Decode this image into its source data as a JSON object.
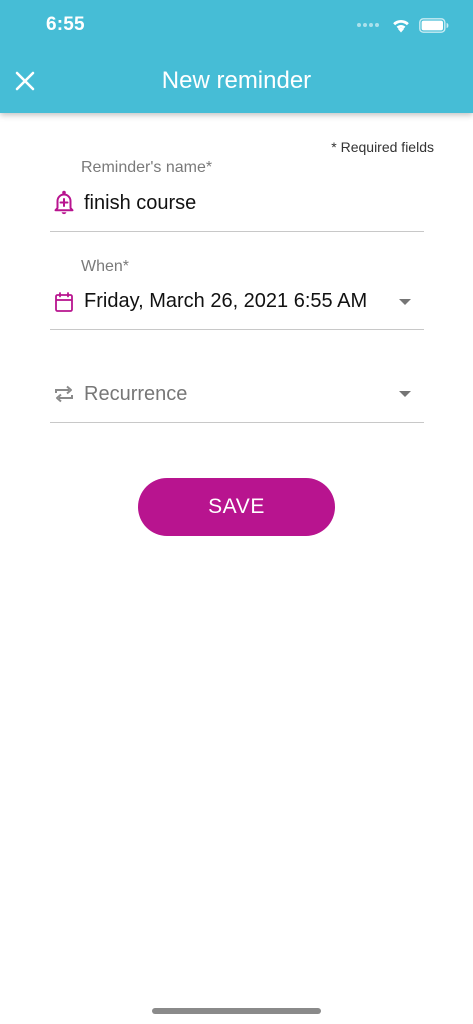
{
  "status_bar": {
    "time": "6:55"
  },
  "header": {
    "title": "New reminder",
    "background_color": "#46bdd6",
    "close_icon": "close-icon"
  },
  "form": {
    "required_note": "* Required fields",
    "name_field": {
      "label": "Reminder's name*",
      "value": "finish course",
      "icon": "bell-plus-icon"
    },
    "when_field": {
      "label": "When*",
      "value": "Friday, March 26, 2021 6:55 AM",
      "icon": "calendar-icon"
    },
    "recurrence_field": {
      "placeholder": "Recurrence",
      "icon": "repeat-icon"
    },
    "accent_color": "#b8148f"
  },
  "actions": {
    "save_label": "SAVE",
    "save_color": "#b8148f"
  }
}
